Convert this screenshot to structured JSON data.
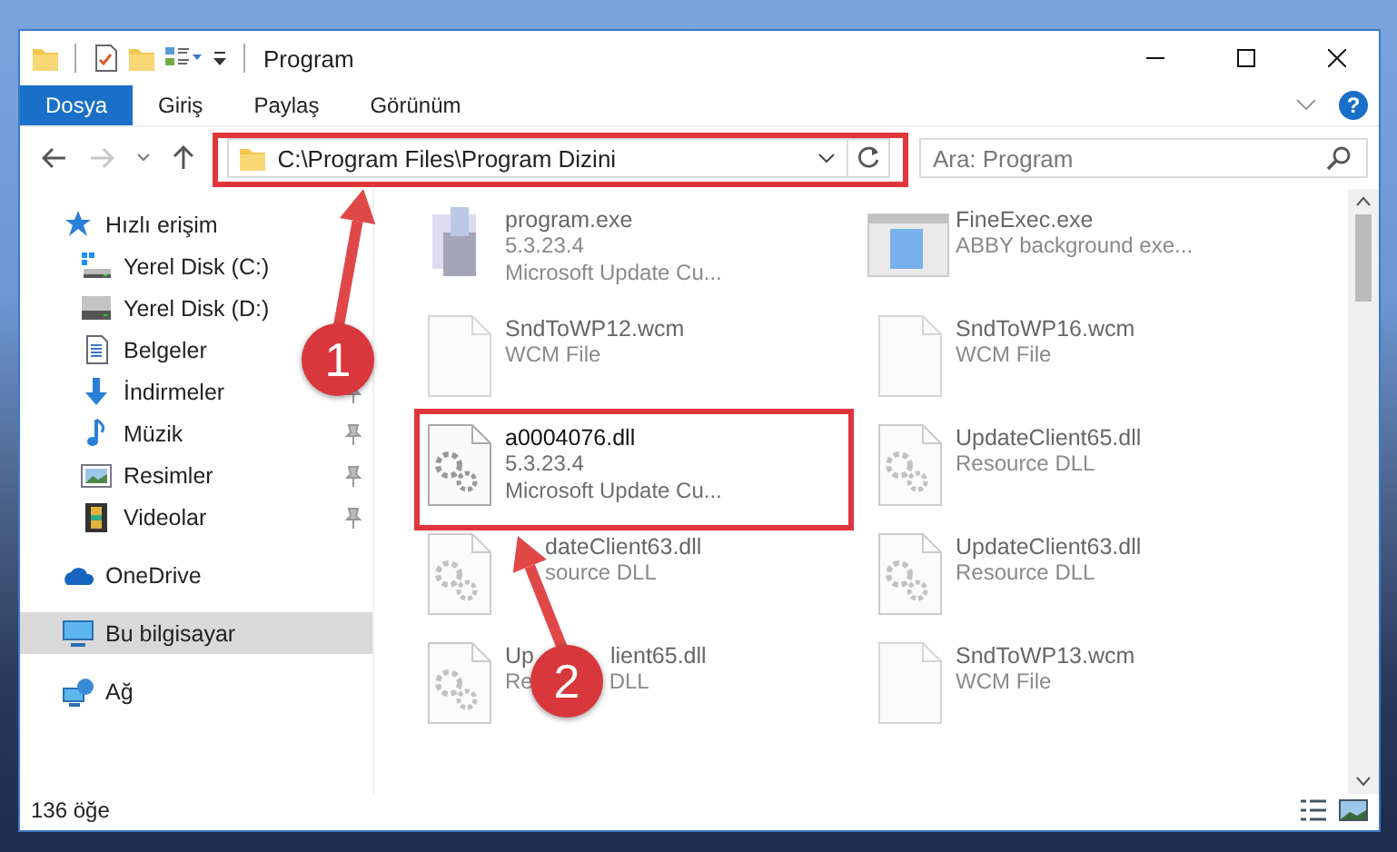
{
  "window": {
    "title": "Program"
  },
  "ribbon": {
    "tabs": [
      {
        "label": "Dosya",
        "selected": true
      },
      {
        "label": "Giriş",
        "selected": false
      },
      {
        "label": "Paylaş",
        "selected": false
      },
      {
        "label": "Görünüm",
        "selected": false
      }
    ],
    "help": "?"
  },
  "navigation": {
    "forward_disabled": true
  },
  "address": {
    "path": "C:\\Program Files\\Program Dizini"
  },
  "search": {
    "placeholder": "Ara: Program"
  },
  "sidebar": {
    "items": [
      {
        "label": "Hızlı erişim",
        "kind": "star",
        "selected": false,
        "children": [
          {
            "label": "Yerel Disk (C:)",
            "kind": "drive-windows",
            "pinned": false
          },
          {
            "label": "Yerel Disk (D:)",
            "kind": "drive",
            "pinned": false
          },
          {
            "label": "Belgeler",
            "kind": "documents",
            "pinned": false
          },
          {
            "label": "İndirmeler",
            "kind": "download",
            "pinned": true
          },
          {
            "label": "Müzik",
            "kind": "music",
            "pinned": true
          },
          {
            "label": "Resimler",
            "kind": "pictures",
            "pinned": true
          },
          {
            "label": "Videolar",
            "kind": "videos",
            "pinned": true
          }
        ]
      },
      {
        "label": "OneDrive",
        "kind": "cloud",
        "selected": false
      },
      {
        "label": "Bu bilgisayar",
        "kind": "computer",
        "selected": true
      },
      {
        "label": "Ağ",
        "kind": "network",
        "selected": false
      }
    ]
  },
  "files": [
    {
      "name": [
        "program.exe"
      ],
      "lines": [
        [
          "5.3.23.4"
        ],
        [
          "Microsoft Update Cu..."
        ]
      ],
      "kind": "installer",
      "dimmed": true
    },
    {
      "name": [
        "FineExec.exe"
      ],
      "lines": [
        [
          "ABBY background exe..."
        ]
      ],
      "kind": "window",
      "dimmed": true
    },
    {
      "name": [
        "SndToWP12.wcm"
      ],
      "lines": [
        [
          "WCM File"
        ]
      ],
      "kind": "blank",
      "dimmed": true
    },
    {
      "name": [
        "SndToWP16.wcm"
      ],
      "lines": [
        [
          "WCM File"
        ]
      ],
      "kind": "blank",
      "dimmed": true
    },
    {
      "name": [
        "a0004076.dll"
      ],
      "lines": [
        [
          "5.3.23.4"
        ],
        [
          "Microsoft Update Cu..."
        ]
      ],
      "kind": "dll",
      "dimmed": false
    },
    {
      "name": [
        "UpdateClient65.dll"
      ],
      "lines": [
        [
          "Resource DLL"
        ]
      ],
      "kind": "dll",
      "dimmed": true
    },
    {
      "name": [
        "dateClient63.dll"
      ],
      "lines": [
        [
          "source DLL"
        ]
      ],
      "kind": "dll",
      "dimmed": true
    },
    {
      "name": [
        "UpdateClient63.dll"
      ],
      "lines": [
        [
          "Resource DLL"
        ]
      ],
      "kind": "dll",
      "dimmed": true
    },
    {
      "name": [
        "Up",
        "lient65.dll"
      ],
      "lines": [
        [
          "Re",
          "DLL"
        ]
      ],
      "kind": "dll",
      "dimmed": true
    },
    {
      "name": [
        "SndToWP13.wcm"
      ],
      "lines": [
        [
          "WCM File"
        ]
      ],
      "kind": "blank",
      "dimmed": true
    }
  ],
  "status_bar": {
    "count": "136 öğe"
  },
  "callouts": [
    {
      "number": "1"
    },
    {
      "number": "2"
    }
  ]
}
